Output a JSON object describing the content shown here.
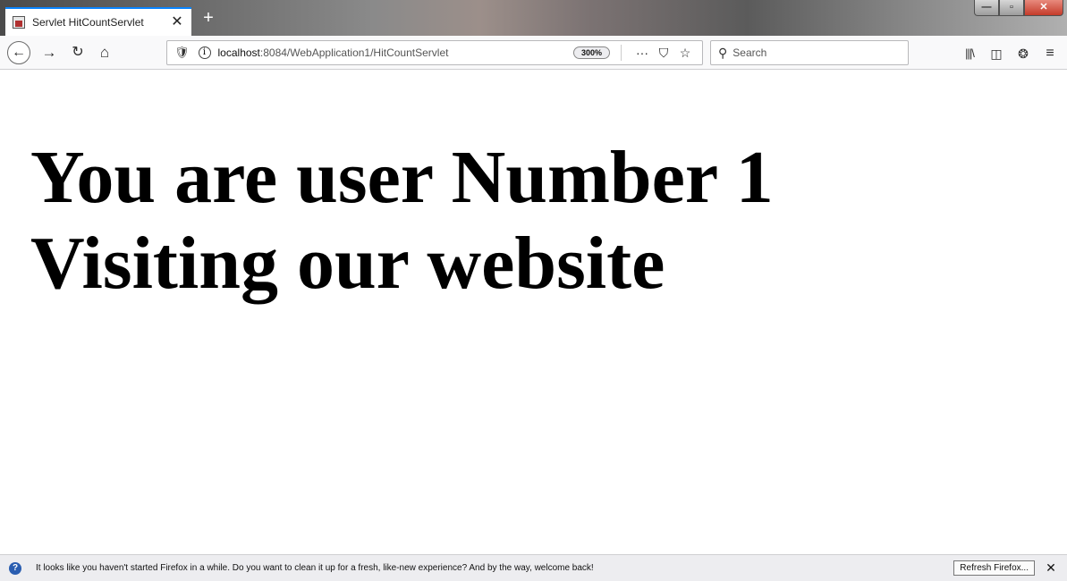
{
  "tab": {
    "title": "Servlet HitCountServlet",
    "close_glyph": "✕",
    "new_tab_glyph": "+"
  },
  "window_controls": {
    "minimize": "—",
    "restore": "▫",
    "close": "✕"
  },
  "nav": {
    "back_icon": "back-arrow-icon",
    "forward_icon": "forward-arrow-icon",
    "reload_icon": "reload-icon",
    "home_icon": "home-icon"
  },
  "urlbar": {
    "host": "localhost",
    "path": ":8084/WebApplication1/HitCountServlet",
    "zoom": "300%",
    "actions": [
      "page-actions-icon",
      "pocket-icon",
      "bookmark-star-icon"
    ]
  },
  "search": {
    "placeholder": "Search"
  },
  "toolbar_icons": [
    "library-icon",
    "sidebar-icon",
    "extension-icon",
    "menu-icon"
  ],
  "page": {
    "line1": "You are user Number 1",
    "line2": "Visiting our website"
  },
  "notification": {
    "message": "It looks like you haven't started Firefox in a while. Do you want to clean it up for a fresh, like-new experience? And by the way, welcome back!",
    "button_label": "Refresh Firefox...",
    "close_glyph": "✕"
  },
  "colors": {
    "tab_accent": "#0a84ff",
    "toolbar_bg": "#f9f9fa",
    "notification_bg": "#ededf0"
  }
}
